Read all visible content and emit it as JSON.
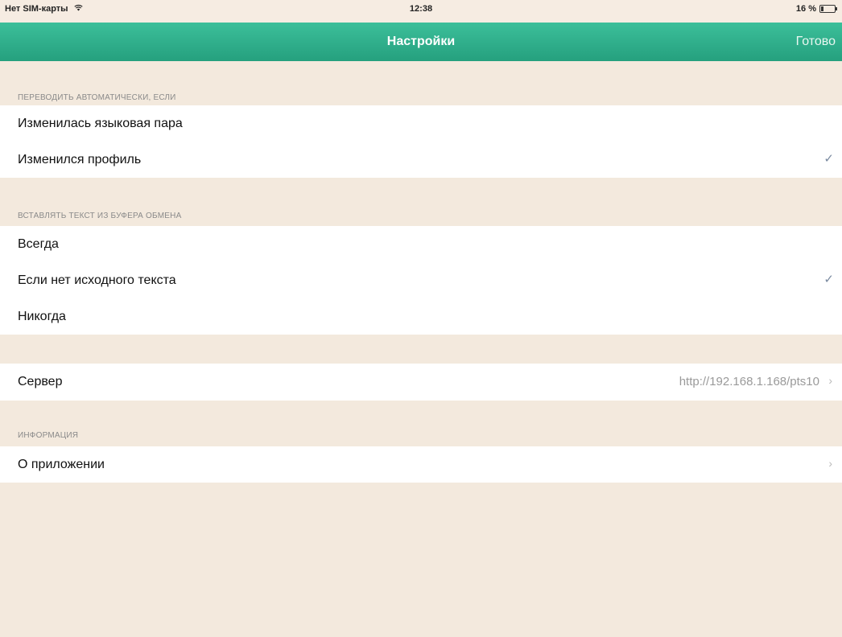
{
  "status_bar": {
    "carrier": "Нет SIM-карты",
    "wifi_icon": "wifi-icon",
    "time": "12:38",
    "battery_percent": "16 %",
    "battery_level": 0.16
  },
  "nav": {
    "title": "Настройки",
    "done_label": "Готово"
  },
  "sections": {
    "auto_translate": {
      "header": "ПЕРЕВОДИТЬ АВТОМАТИЧЕСКИ, ЕСЛИ",
      "items": [
        {
          "label": "Изменилась языковая пара",
          "checked": false
        },
        {
          "label": "Изменился профиль",
          "checked": true
        }
      ]
    },
    "clipboard": {
      "header": "ВСТАВЛЯТЬ ТЕКСТ ИЗ БУФЕРА ОБМЕНА",
      "items": [
        {
          "label": "Всегда",
          "checked": false
        },
        {
          "label": "Если нет исходного текста",
          "checked": true
        },
        {
          "label": "Никогда",
          "checked": false
        }
      ]
    },
    "server": {
      "label": "Сервер",
      "value": "http://192.168.1.168/pts10"
    },
    "info": {
      "header": "ИНФОРМАЦИЯ",
      "items": [
        {
          "label": "О приложении"
        }
      ]
    }
  },
  "icons": {
    "checkmark": "✓",
    "chevron": "›"
  },
  "colors": {
    "nav_bar": "#2fb08b",
    "background": "#f3e9dd",
    "checkmark": "#7a8aa0"
  }
}
